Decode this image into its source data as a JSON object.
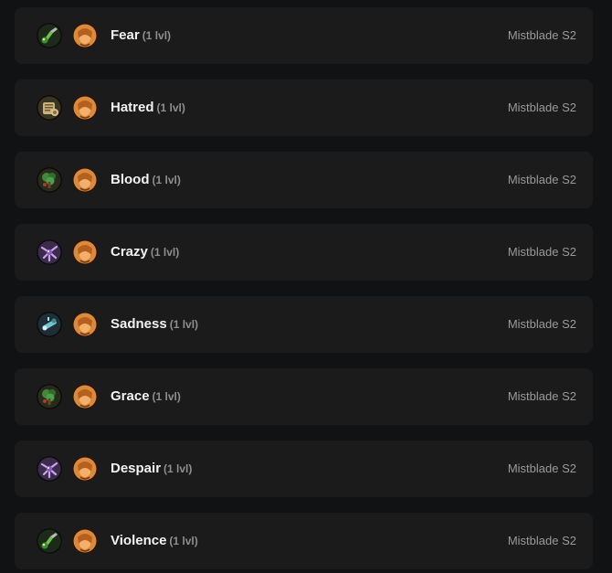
{
  "rows": [
    {
      "name": "Fear",
      "level": "(1 lvl)",
      "source": "Mistblade S2",
      "skill_icon": "green-potion-icon",
      "class_icon": "orange-portrait-icon"
    },
    {
      "name": "Hatred",
      "level": "(1 lvl)",
      "source": "Mistblade S2",
      "skill_icon": "golden-scroll-icon",
      "class_icon": "orange-portrait-icon"
    },
    {
      "name": "Blood",
      "level": "(1 lvl)",
      "source": "Mistblade S2",
      "skill_icon": "green-tree-icon",
      "class_icon": "orange-portrait-icon"
    },
    {
      "name": "Crazy",
      "level": "(1 lvl)",
      "source": "Mistblade S2",
      "skill_icon": "purple-creature-icon",
      "class_icon": "orange-portrait-icon"
    },
    {
      "name": "Sadness",
      "level": "(1 lvl)",
      "source": "Mistblade S2",
      "skill_icon": "teal-mechanism-icon",
      "class_icon": "orange-portrait-icon"
    },
    {
      "name": "Grace",
      "level": "(1 lvl)",
      "source": "Mistblade S2",
      "skill_icon": "green-tree-icon",
      "class_icon": "orange-portrait-icon"
    },
    {
      "name": "Despair",
      "level": "(1 lvl)",
      "source": "Mistblade S2",
      "skill_icon": "purple-creature-icon",
      "class_icon": "orange-portrait-icon"
    },
    {
      "name": "Violence",
      "level": "(1 lvl)",
      "source": "Mistblade S2",
      "skill_icon": "green-potion-icon",
      "class_icon": "orange-portrait-icon"
    }
  ],
  "colors": {
    "background": "#111214",
    "row_background": "#1b1b1c",
    "name_text": "#f2f2f2",
    "level_text": "#8e8e8e",
    "source_text": "#9a9a9a"
  }
}
